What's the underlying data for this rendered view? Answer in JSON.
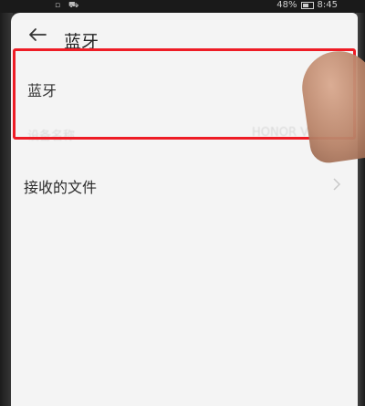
{
  "status_bar": {
    "battery_percent": "48%",
    "time": "8:45"
  },
  "header": {
    "back_icon": "arrow-left-icon",
    "title": "蓝牙"
  },
  "settings": {
    "bluetooth_label": "蓝牙",
    "device_name_label": "设备名称",
    "device_name_value": "HONOR V",
    "received_files_label": "接收的文件"
  },
  "colors": {
    "highlight": "#ee1c25",
    "background": "#f4f4f4"
  }
}
